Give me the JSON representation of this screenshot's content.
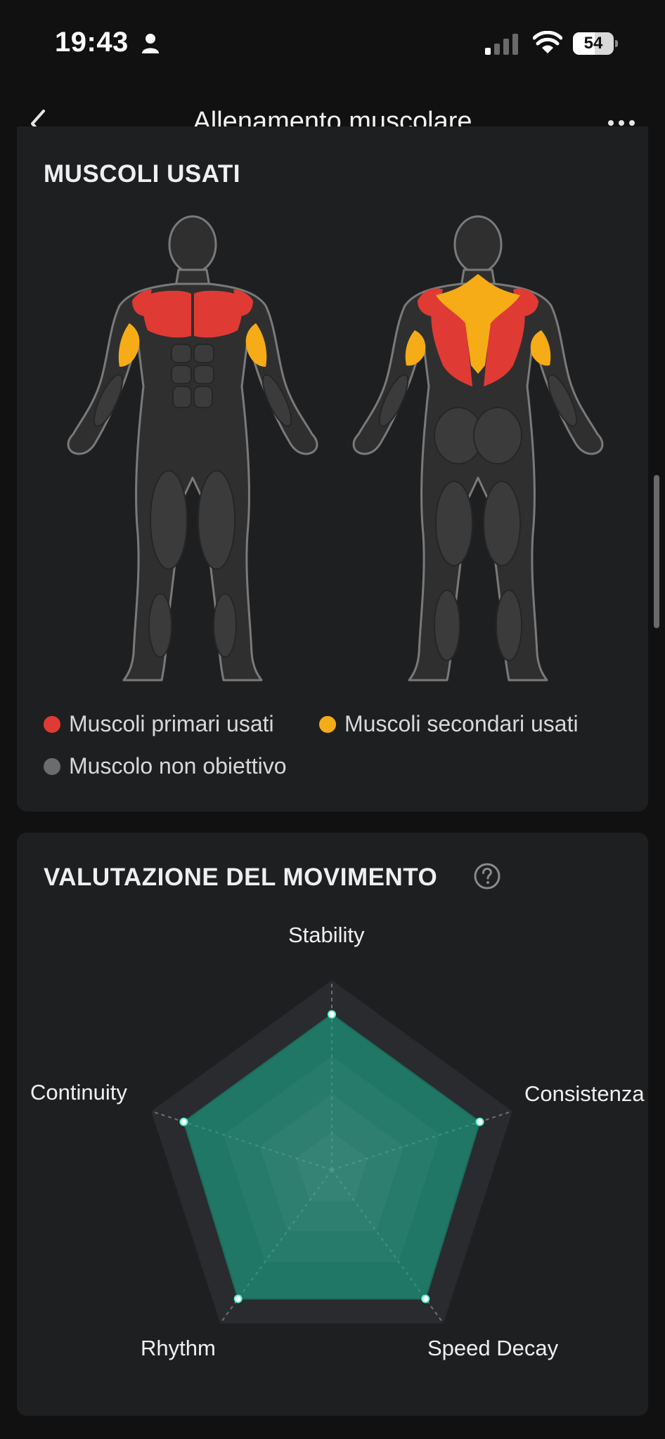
{
  "status_bar": {
    "time": "19:43",
    "battery": 54,
    "battery_label": "54",
    "icons": [
      "person-icon",
      "signal-icon",
      "wifi-icon",
      "battery-icon"
    ]
  },
  "nav": {
    "back_icon": "chevron-left-icon",
    "title": "Allenamento muscolare",
    "more_icon": "more-horizontal-icon"
  },
  "muscles": {
    "title": "MUSCOLI USATI",
    "legend": [
      {
        "label": "Muscoli primari usati",
        "color": "#e03a35"
      },
      {
        "label": "Muscoli secondari usati",
        "color": "#f6ac16"
      },
      {
        "label": "Muscolo non obiettivo",
        "color": "#6c6c6c"
      }
    ],
    "colors": {
      "primary": "#e03a35",
      "secondary": "#f6ac16",
      "inactive": "#3e3e3e"
    }
  },
  "evaluation": {
    "title": "VALUTAZIONE DEL MOVIMENTO",
    "help_icon": "help-circle-icon",
    "chart_data": {
      "type": "radar",
      "axes": [
        "Stability",
        "Consistenza",
        "Speed Decay",
        "Rhythm",
        "Continuity"
      ],
      "values": [
        0.82,
        0.82,
        0.84,
        0.84,
        0.82
      ],
      "range": [
        0,
        1
      ],
      "fill_color": "#1f7e6b",
      "point_color": "#5ef2cf"
    }
  }
}
